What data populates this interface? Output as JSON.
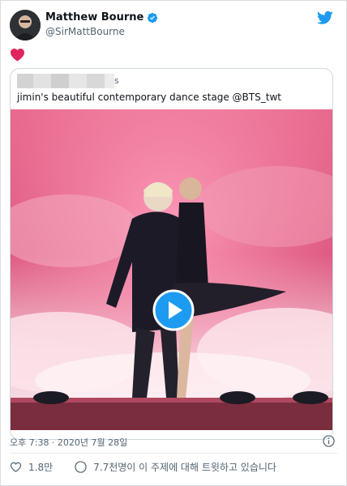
{
  "author": {
    "name": "Matthew Bourne",
    "handle": "@SirMattBourne"
  },
  "tweet": {
    "emoji": "red-heart",
    "timestamp": "오후 7:38 · 2020년 7월 28일"
  },
  "quoted": {
    "name_suffix": "s",
    "text": "jimin's beautiful contemporary dance stage @BTS_twt"
  },
  "actions": {
    "likes": "1.8만",
    "discussion": "7.7천명이 이 주제에 대해 트윗하고 있습니다"
  },
  "colors": {
    "accent": "#1d9bf0",
    "heart": "#e0245e",
    "muted": "#536471"
  }
}
